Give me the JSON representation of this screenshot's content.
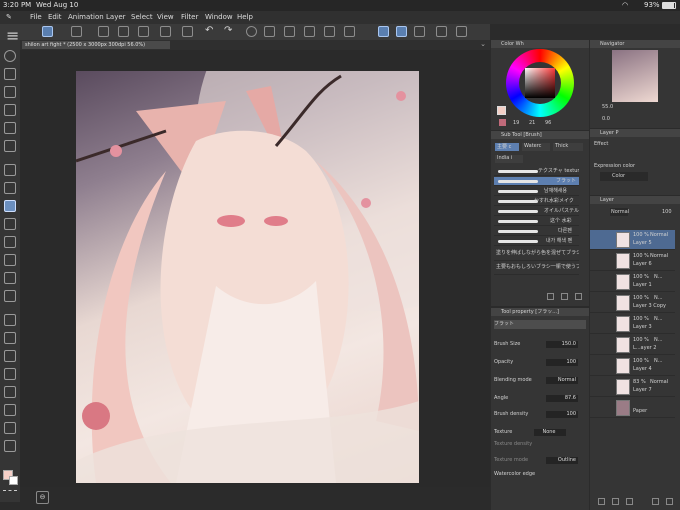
{
  "status": {
    "time": "3:20 PM",
    "date": "Wed Aug 10",
    "battery": "93%"
  },
  "menu": [
    "File",
    "Edit",
    "Animation",
    "Layer",
    "Select",
    "View",
    "Filter",
    "Window",
    "Help"
  ],
  "document_tab": "shilon art fight * (2500 x 3000px 300dpi 56.0%)",
  "color_wheel": {
    "title": "Color Wh",
    "values": [
      "19",
      "21",
      "96"
    ],
    "hue_color": "#ff3b3b",
    "swatch": "#c06a7a",
    "main_color": "#f3cfc6"
  },
  "navigator": {
    "title": "Navigator",
    "zoom": "55.0",
    "rotation": "0.0"
  },
  "layer_property": {
    "title": "Layer P",
    "effect_label": "Effect",
    "expression_label": "Expression color",
    "expression_value": "Color"
  },
  "sub_tool": {
    "title": "Sub Tool [Brush]",
    "tabs": [
      "主要 c",
      "Waterc",
      "Thick",
      "India i"
    ],
    "brushes": [
      "テクスチャ texture brush",
      "フラット",
      "남재해새용",
      "かすれ水彩メイク",
      "オイルパステル",
      "这个 水彩",
      "다른펜",
      "내가 해색 펜",
      "塗りを伸ばしながら色を混ぜてブラシ",
      "主要もおもしろいブラシ一賑で使うブラシ"
    ]
  },
  "tool_property": {
    "title": "Tool property [フラッ...]",
    "brush_name": "フラット",
    "brush_size_label": "Brush Size",
    "brush_size": "150.0",
    "opacity_label": "Opacity",
    "opacity": "100",
    "blending_label": "Blending mode",
    "blending": "Normal",
    "angle_label": "Angle",
    "angle": "87.6",
    "density_label": "Brush density",
    "density": "100",
    "texture_label": "Texture",
    "texture": "None",
    "texture_density_label": "Texture density",
    "texture_mode_label": "Texture mode",
    "texture_mode": "Outline",
    "watercolor_label": "Watercolor edge"
  },
  "layer_panel": {
    "title": "Layer",
    "blend": "Normal",
    "opacity": "100",
    "layers": [
      {
        "pct": "100 %",
        "mode": "Normal",
        "name": "Layer 5"
      },
      {
        "pct": "100 %",
        "mode": "Normal",
        "name": "Layer 6"
      },
      {
        "pct": "100 %",
        "mode": "N...",
        "name": "Layer 1"
      },
      {
        "pct": "100 %",
        "mode": "N...",
        "name": "Layer 3 Copy"
      },
      {
        "pct": "100 %",
        "mode": "N...",
        "name": "Layer 3"
      },
      {
        "pct": "100 %",
        "mode": "N...",
        "name": "L...ayer 2"
      },
      {
        "pct": "100 %",
        "mode": "N...",
        "name": "Layer 4"
      },
      {
        "pct": "83 %",
        "mode": "Normal",
        "name": "Layer 7"
      },
      {
        "pct": "",
        "mode": "",
        "name": "Paper"
      }
    ]
  },
  "bottom": {
    "page_icon": "⊖"
  }
}
